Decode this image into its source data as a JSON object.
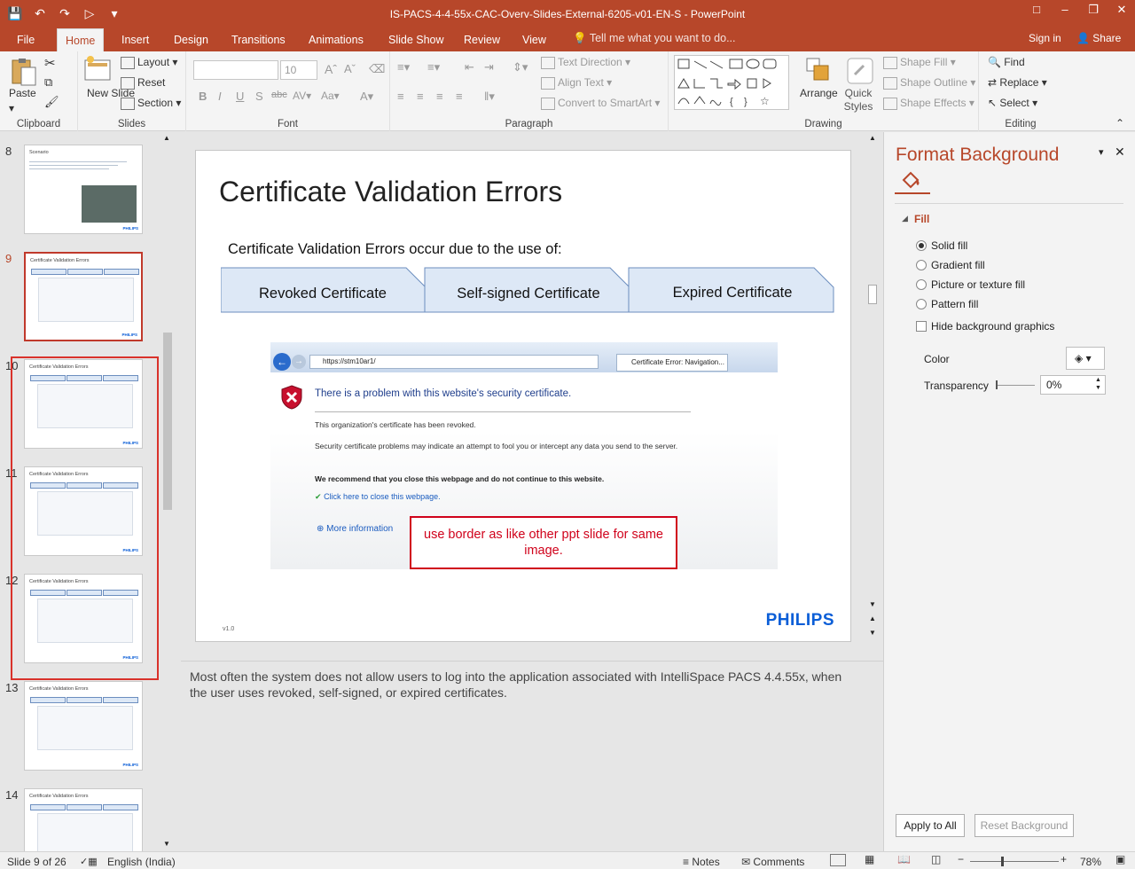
{
  "window": {
    "title": "IS-PACS-4-4-55x-CAC-Overv-Slides-External-6205-v01-EN-S - PowerPoint",
    "controls": [
      "ribbon-display-icon",
      "minimize-icon",
      "restore-icon",
      "close-icon"
    ]
  },
  "tabs": {
    "file": "File",
    "home": "Home",
    "insert": "Insert",
    "design": "Design",
    "transitions": "Transitions",
    "animations": "Animations",
    "slideshow": "Slide Show",
    "review": "Review",
    "view": "View",
    "tellme": "Tell me what you want to do...",
    "signin": "Sign in",
    "share": "Share"
  },
  "ribbon": {
    "clipboard": {
      "label": "Clipboard",
      "paste": "Paste"
    },
    "slides": {
      "label": "Slides",
      "new_slide": "New Slide",
      "layout": "Layout",
      "reset": "Reset",
      "section": "Section"
    },
    "font": {
      "label": "Font",
      "size": "10"
    },
    "paragraph": {
      "label": "Paragraph",
      "text_direction": "Text Direction",
      "align_text": "Align Text",
      "smartart": "Convert to SmartArt"
    },
    "drawing": {
      "label": "Drawing",
      "arrange": "Arrange",
      "quick_styles": "Quick Styles",
      "shape_fill": "Shape Fill",
      "shape_outline": "Shape Outline",
      "shape_effects": "Shape Effects"
    },
    "editing": {
      "label": "Editing",
      "find": "Find",
      "replace": "Replace",
      "select": "Select"
    }
  },
  "thumbnails": [
    {
      "num": "8",
      "title": "Scenario"
    },
    {
      "num": "9",
      "title": "Certificate Validation Errors",
      "selected": true
    },
    {
      "num": "10",
      "title": "Certificate Validation Errors"
    },
    {
      "num": "11",
      "title": "Certificate Validation Errors"
    },
    {
      "num": "12",
      "title": "Certificate Validation Errors"
    },
    {
      "num": "13",
      "title": "Certificate Validation Errors"
    },
    {
      "num": "14",
      "title": "Certificate Validation Errors"
    }
  ],
  "thumb_philips": "PHILIPS",
  "slide": {
    "title": "Certificate Validation Errors",
    "subtitle": "Certificate Validation Errors occur due to the use of:",
    "steps": [
      "Revoked Certificate",
      "Self-signed Certificate",
      "Expired Certificate"
    ],
    "screenshot": {
      "url": "https://stm10ar1/",
      "tab": "Certificate Error: Navigation...",
      "heading": "There is a problem with this website's security certificate.",
      "p1": "This organization's certificate has been revoked.",
      "p2": "Security certificate problems may indicate an attempt to fool you or intercept any data you send to the server.",
      "bold": "We recommend that you close this webpage and do not continue to this website.",
      "link1": "Click here to close this webpage.",
      "link2": "More information"
    },
    "annotation": "use border as like other ppt slide for same image.",
    "version": "v1.0",
    "logo": "PHILIPS"
  },
  "notes": "Most often the system does not allow users to log into the application associated with IntelliSpace PACS 4.4.55x, when the user uses revoked, self-signed, or expired certificates.",
  "format_panel": {
    "title": "Format Background",
    "section": "Fill",
    "options": [
      "Solid fill",
      "Gradient fill",
      "Picture or texture fill",
      "Pattern fill"
    ],
    "selected_option": "Solid fill",
    "hide_bg": "Hide background graphics",
    "color_label": "Color",
    "transparency_label": "Transparency",
    "transparency_value": "0%",
    "apply_all": "Apply to All",
    "reset_bg": "Reset Background"
  },
  "status": {
    "slide": "Slide 9 of 26",
    "language": "English (India)",
    "notes": "Notes",
    "comments": "Comments",
    "zoom": "78%"
  },
  "colors": {
    "accent": "#b7472a",
    "annotation": "#d0021b",
    "chevron_fill": "#dde8f6",
    "chevron_stroke": "#6c8ebf"
  }
}
